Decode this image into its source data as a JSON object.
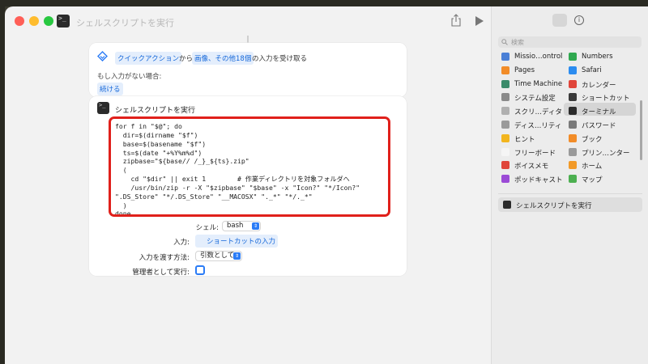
{
  "window": {
    "title": "シェルスクリプトを実行"
  },
  "toolbar": {
    "share_icon": "share-icon",
    "run_icon": "play-icon"
  },
  "quick_action": {
    "chip_label": "クイックアクション",
    "from_text": "から",
    "types_chip": "画像、その他18個",
    "receive_text": "の入力を受け取る",
    "no_input_label": "もし入力がない場合:",
    "no_input_value": "続ける"
  },
  "action": {
    "title": "シェルスクリプトを実行",
    "script_lines": [
      "for f in \"$@\"; do",
      "  dir=$(dirname \"$f\")",
      "  base=$(basename \"$f\")",
      "  ts=$(date \"+%Y%m%d\")",
      "  zipbase=\"${base// /_}_${ts}.zip\"",
      "  (",
      "    cd \"$dir\" || exit 1        # 作業ディレクトリを対象フォルダへ",
      "    /usr/bin/zip -r -X \"$zipbase\" \"$base\" -x \"Icon?\" \"*/Icon?\"",
      "\".DS_Store\" \"*/.DS_Store\" \"__MACOSX\" \"._*\" \"*/._*\"",
      "  )",
      "done"
    ],
    "shell_label": "シェル:",
    "shell_value": "bash",
    "input_label": "入力:",
    "input_value": "ショートカットの入力",
    "pass_label": "入力を渡す方法:",
    "pass_value": "引数として",
    "admin_label": "管理者として実行:"
  },
  "sidebar": {
    "search_placeholder": "検索",
    "items_left": [
      {
        "label": "Missio…ontrol",
        "color": "#4a7fd6"
      },
      {
        "label": "Pages",
        "color": "#f28c28"
      },
      {
        "label": "Time Machine",
        "color": "#3a8a6a"
      },
      {
        "label": "システム設定",
        "color": "#8a8a8a"
      },
      {
        "label": "スクリ…ディタ",
        "color": "#b0b0b0"
      },
      {
        "label": "ディス…リティ",
        "color": "#9a9a9a"
      },
      {
        "label": "ヒント",
        "color": "#f2b51e"
      },
      {
        "label": "フリーボード",
        "color": "#f5f5f5"
      },
      {
        "label": "ボイスメモ",
        "color": "#e0453a"
      },
      {
        "label": "ポッドキャスト",
        "color": "#9b4bd6"
      }
    ],
    "items_right": [
      {
        "label": "Numbers",
        "color": "#2fa84f"
      },
      {
        "label": "Safari",
        "color": "#2b8cf0"
      },
      {
        "label": "カレンダー",
        "color": "#e0453a"
      },
      {
        "label": "ショートカット",
        "color": "#3a3a3a"
      },
      {
        "label": "ターミナル",
        "color": "#2b2b2b"
      },
      {
        "label": "パスワード",
        "color": "#7a7a7a"
      },
      {
        "label": "ブック",
        "color": "#f28c28"
      },
      {
        "label": "プリン…ンター",
        "color": "#9a9a9a"
      },
      {
        "label": "ホーム",
        "color": "#f29a28"
      },
      {
        "label": "マップ",
        "color": "#4caf50"
      }
    ],
    "selected_action": "シェルスクリプトを実行"
  }
}
